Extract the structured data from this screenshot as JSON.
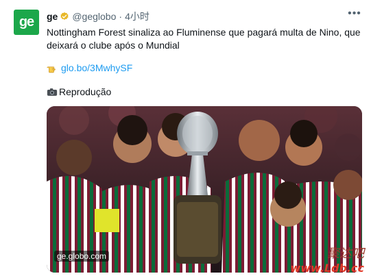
{
  "account": {
    "name": "ge",
    "handle": "@geglobo",
    "separator": "·",
    "time": "4小时",
    "avatar_text": "ge"
  },
  "tweet": {
    "text": "Nottingham Forest sinaliza ao Fluminense que pagará multa de Nino, que deixará o clube após o Mundial",
    "link": "glo.bo/3MwhySF",
    "credit": "Reprodução"
  },
  "media": {
    "domain": "ge.globo.com"
  },
  "watermark": {
    "chinese": "聚达吧",
    "url": "www.Ldb.cc"
  },
  "colors": {
    "brand_green": "#1ca74a",
    "link_blue": "#1d9bf0",
    "verified_gold": "#e8b829",
    "maroon": "#7b1c33",
    "green_stripe": "#0b6b3a"
  },
  "icons": {
    "more": "more-horizontal-icon",
    "badge": "verified-gold-badge-icon",
    "pointer": "pointing-hand-emoji",
    "camera": "camera-emoji"
  }
}
